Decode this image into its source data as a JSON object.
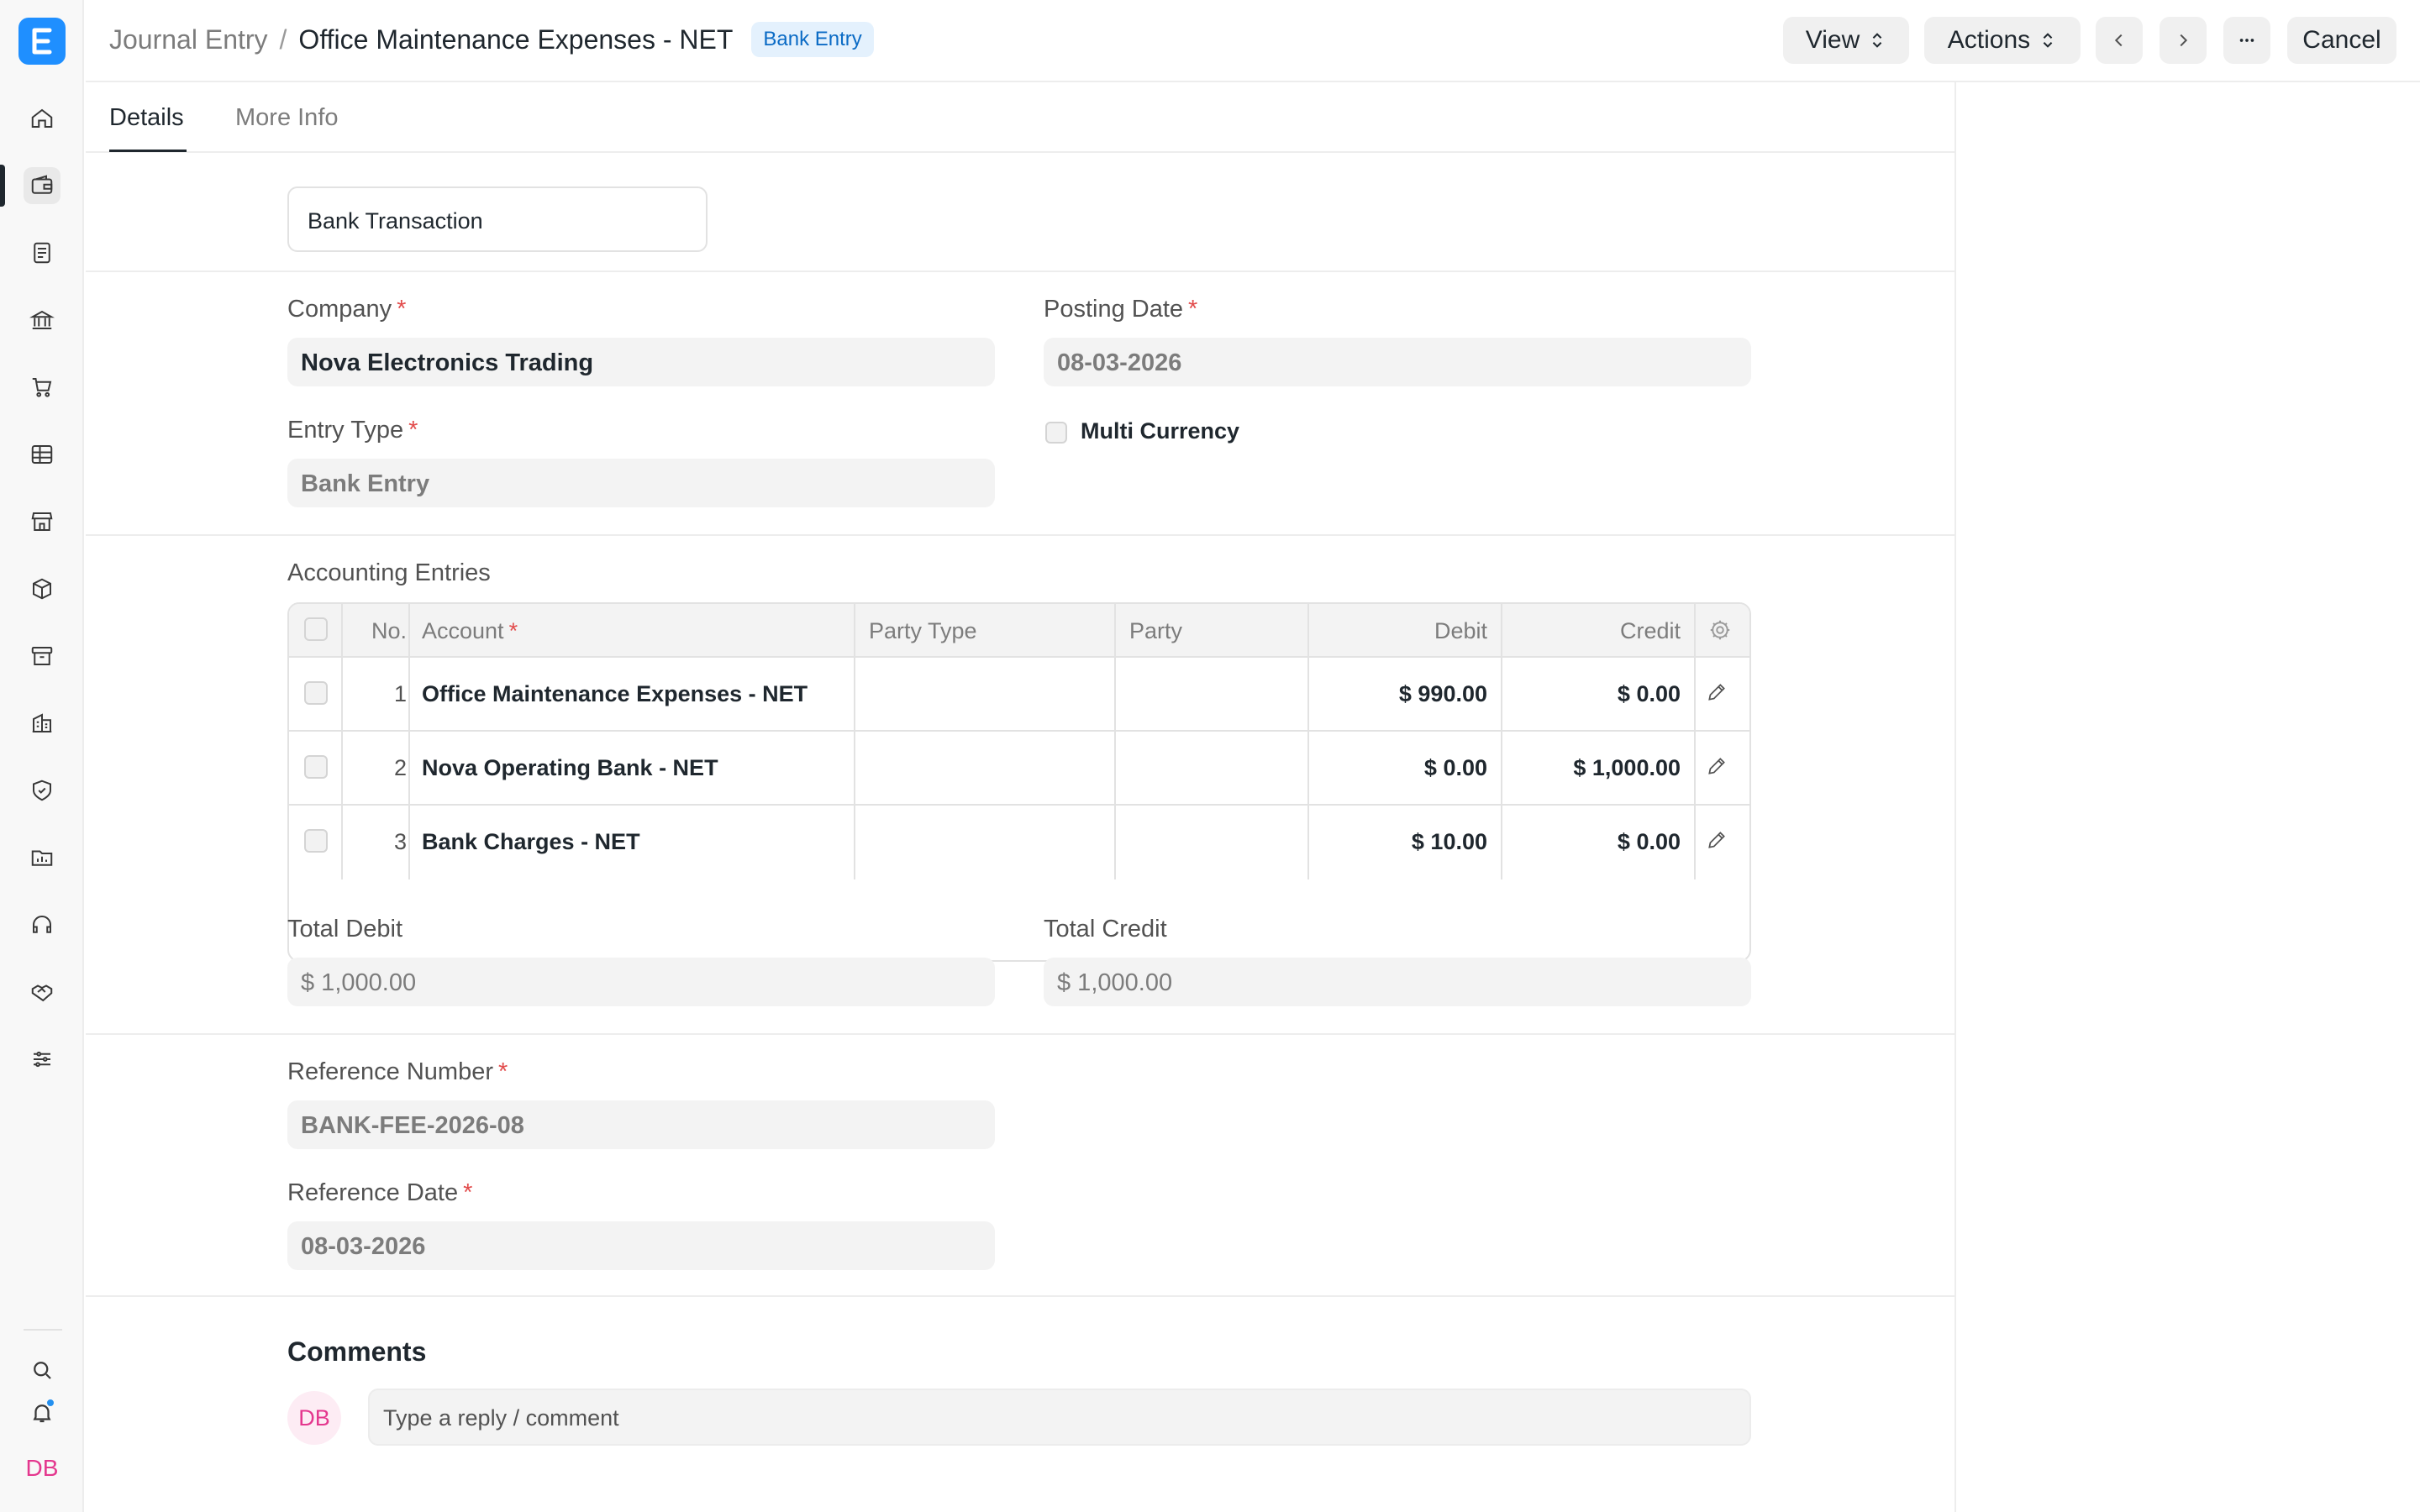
{
  "sidebar": {
    "logo_letter": "E",
    "items": [
      {
        "icon": "home-icon"
      },
      {
        "icon": "wallet-icon",
        "active": true
      },
      {
        "icon": "document-icon"
      },
      {
        "icon": "bank-icon"
      },
      {
        "icon": "cart-icon"
      },
      {
        "icon": "table-icon"
      },
      {
        "icon": "store-icon"
      },
      {
        "icon": "box-icon"
      },
      {
        "icon": "archive-icon"
      },
      {
        "icon": "building-icon"
      },
      {
        "icon": "shield-icon"
      },
      {
        "icon": "folder-chart-icon"
      },
      {
        "icon": "headset-icon"
      },
      {
        "icon": "handshake-icon"
      },
      {
        "icon": "sliders-icon"
      }
    ],
    "bottom": {
      "search_icon": "search-icon",
      "bell_icon": "bell-icon",
      "avatar_initials": "DB"
    }
  },
  "header": {
    "breadcrumb_parent": "Journal Entry",
    "separator": "/",
    "title": "Office Maintenance Expenses - NET",
    "status_badge": "Bank Entry",
    "view_label": "View",
    "actions_label": "Actions",
    "cancel_label": "Cancel"
  },
  "tabs": [
    {
      "label": "Details",
      "active": true
    },
    {
      "label": "More Info",
      "active": false
    }
  ],
  "form": {
    "title_field_value": "Bank Transaction",
    "company": {
      "label": "Company",
      "value": "Nova Electronics Trading"
    },
    "posting_date": {
      "label": "Posting Date",
      "value": "08-03-2026"
    },
    "entry_type": {
      "label": "Entry Type",
      "value": "Bank Entry"
    },
    "multi_currency": {
      "label": "Multi Currency",
      "checked": false
    },
    "accounting_entries_label": "Accounting Entries",
    "table": {
      "headers": {
        "no": "No.",
        "account": "Account",
        "party_type": "Party Type",
        "party": "Party",
        "debit": "Debit",
        "credit": "Credit"
      },
      "rows": [
        {
          "no": "1",
          "account": "Office Maintenance Expenses - NET",
          "party_type": "",
          "party": "",
          "debit": "$ 990.00",
          "credit": "$ 0.00"
        },
        {
          "no": "2",
          "account": "Nova Operating Bank - NET",
          "party_type": "",
          "party": "",
          "debit": "$ 0.00",
          "credit": "$ 1,000.00"
        },
        {
          "no": "3",
          "account": "Bank Charges - NET",
          "party_type": "",
          "party": "",
          "debit": "$ 10.00",
          "credit": "$ 0.00"
        }
      ]
    },
    "total_debit": {
      "label": "Total Debit",
      "value": "$ 1,000.00"
    },
    "total_credit": {
      "label": "Total Credit",
      "value": "$ 1,000.00"
    },
    "reference_number": {
      "label": "Reference Number",
      "value": "BANK-FEE-2026-08"
    },
    "reference_date": {
      "label": "Reference Date",
      "value": "08-03-2026"
    }
  },
  "comments": {
    "title": "Comments",
    "avatar_initials": "DB",
    "placeholder": "Type a reply / comment"
  },
  "colors": {
    "accent": "#1f8fff",
    "badge_bg": "#e4f1fd",
    "badge_text": "#0b6bc5",
    "required": "#e24c4c",
    "avatar": "#e4378e"
  }
}
